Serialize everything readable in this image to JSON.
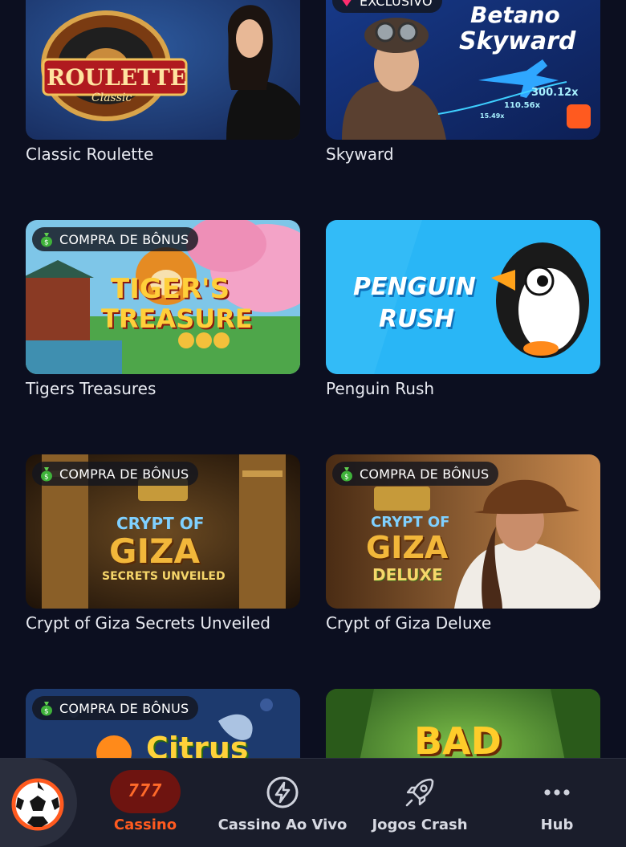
{
  "badges": {
    "bonus": "COMPRA DE BÔNUS",
    "exclusive": "EXCLUSIVO"
  },
  "games": [
    {
      "title": "Classic Roulette",
      "art_text": [
        "ROULETTE",
        "Classic"
      ]
    },
    {
      "title": "Skyward",
      "art_text": [
        "Betano",
        "Skyward",
        "300.12x",
        "110.56x",
        "15.49x"
      ]
    },
    {
      "title": "Tigers Treasures",
      "art_text": [
        "TIGER'S",
        "TREASURE"
      ]
    },
    {
      "title": "Penguin Rush",
      "art_text": [
        "PENGUIN",
        "RUSH"
      ]
    },
    {
      "title": "Crypt of Giza Secrets Unveiled",
      "art_text": [
        "CRYPT OF",
        "GIZA",
        "SECRETS UNVEILED"
      ]
    },
    {
      "title": "Crypt of Giza Deluxe",
      "art_text": [
        "CRYPT OF",
        "GIZA",
        "DELUXE"
      ]
    },
    {
      "title": "",
      "art_text": [
        "Citrus"
      ]
    },
    {
      "title": "",
      "art_text": [
        "BAD"
      ]
    }
  ],
  "nav": {
    "cassino_icon_text": "777",
    "items": [
      {
        "label": "Cassino",
        "icon": "slot-777-icon",
        "active": true
      },
      {
        "label": "Cassino Ao Vivo",
        "icon": "lightning-icon",
        "active": false
      },
      {
        "label": "Jogos Crash",
        "icon": "rocket-icon",
        "active": false
      },
      {
        "label": "Hub",
        "icon": "more-dots-icon",
        "active": false
      }
    ]
  },
  "colors": {
    "background": "#0c0f20",
    "nav_background": "#1a1d2b",
    "accent": "#ff5a1f",
    "active_pill": "#6e1410",
    "penguin_bg": "#29b6f6"
  }
}
